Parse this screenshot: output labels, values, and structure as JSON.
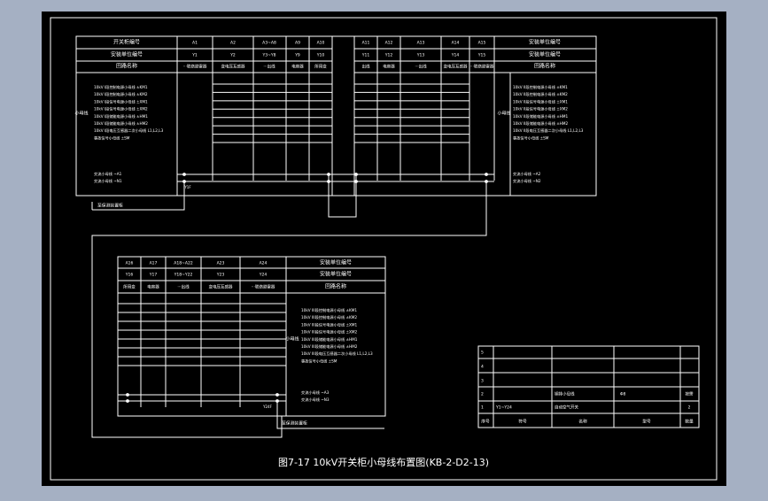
{
  "caption": "图7-17  10kV开关柜小母线布置图(KB-2-D2-13)",
  "upper": {
    "headers": {
      "switch_no": "开关柜编号",
      "unit_no": "安装单位编号",
      "circuit_name": "回路名称",
      "unit_no_right": "安装单位编号"
    },
    "row1_codes": [
      "A1",
      "A2",
      "A3~A8",
      "A9",
      "A10",
      "A11",
      "A12",
      "A13",
      "A14",
      "A15"
    ],
    "row2_codes": [
      "Y1",
      "Y2",
      "Y3~Y8",
      "Y9",
      "Y10",
      "Y11",
      "Y12",
      "Y13",
      "Y14",
      "Y15"
    ],
    "row3_names": [
      "···联络避雷器",
      "变电压互感器",
      "···出线",
      "电容器",
      "所用变",
      "出线",
      "电容器",
      "···出线",
      "变电压互感器",
      "···联络避雷器"
    ],
    "bus_label": "小母线",
    "left_bus_lines": [
      "10kV I段控制电源小母线 ±KM1",
      "10kV I段控制电源小母线 ±KM2",
      "10kV I段信号电源小母线 ±XM1",
      "10kV I段信号电源小母线 ±XM2",
      "10kV I段储能电源小母线 ±HM1",
      "10kV I段储能电源小母线 ±HM2",
      "10kV I段电压互感器二次小母线 L1,L2,L3",
      "事故信号小母线 ±SM"
    ],
    "left_ac_lines": [
      "交流小母线 ~A1",
      "交流小母线 ~N1"
    ],
    "right_bus_lines": [
      "10kV II段控制电源小母线 ±KM1",
      "10kV II段控制电源小母线 ±KM2",
      "10kV II段信号电源小母线 ±XM1",
      "10kV II段信号电源小母线 ±XM2",
      "10kV II段储能电源小母线 ±HM1",
      "10kV II段储能电源小母线 ±HM2",
      "10kV II段电压互感器二次小母线 L1,L2,L3",
      "事故信号小母线 ±SM"
    ],
    "right_ac_lines": [
      "交流小母线 ~A2",
      "交流小母线 ~N2"
    ],
    "terminal_label": "Y1F",
    "feed_label": "至保测装置柜"
  },
  "lower": {
    "headers": {
      "unit_no": "安装单位编号",
      "circuit_name": "回路名称"
    },
    "row1_codes": [
      "A16",
      "A17",
      "A18~A22",
      "A23",
      "A24"
    ],
    "row2_codes": [
      "Y16",
      "Y17",
      "Y18~Y22",
      "Y23",
      "Y24"
    ],
    "row3_names": [
      "所用变",
      "电容器",
      "···出线",
      "变电压互感器",
      "···联络避雷器"
    ],
    "bus_label": "小母线",
    "bus_lines": [
      "10kV III段控制电源小母线 ±KM1",
      "10kV III段控制电源小母线 ±KM2",
      "10kV III段信号电源小母线 ±XM1",
      "10kV III段信号电源小母线 ±XM2",
      "10kV III段储能电源小母线 ±HM1",
      "10kV III段储能电源小母线 ±HM2",
      "10kV III段电压互感器二次小母线 L1,L2,L3",
      "事故信号小母线 ±SM"
    ],
    "ac_lines": [
      "交流小母线 ~A3",
      "交流小母线 ~N3"
    ],
    "terminal_label": "Y24F",
    "feed_label": "至保测装置柜"
  },
  "parts_table": {
    "blank_rows": [
      "5",
      "4",
      "3"
    ],
    "rows": [
      {
        "no": "2",
        "code": "",
        "name": "铜排小母线",
        "spec": "Φ8",
        "qty": "按需"
      },
      {
        "no": "1",
        "code": "Y1~Y24",
        "name": "自动空气开关",
        "spec": "",
        "qty": "2"
      }
    ],
    "header": {
      "no": "序号",
      "code": "符号",
      "name": "名称",
      "spec": "型号",
      "qty": "数量"
    }
  }
}
